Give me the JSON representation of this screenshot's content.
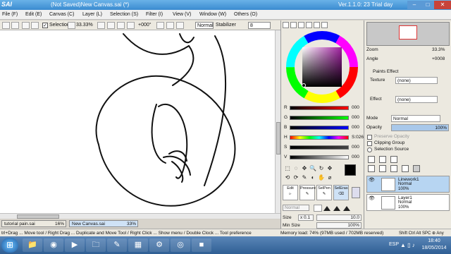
{
  "window": {
    "logo": "SAI",
    "title": "(Not Saved)New Canvas.sai (*)",
    "version": "Ver.1.1.0: 23 Trial day",
    "min_glyph": "–",
    "max_glyph": "□",
    "close_glyph": "✕"
  },
  "menu": [
    "File (F)",
    "Edit (E)",
    "Canvas (C)",
    "Layer (L)",
    "Selection (S)",
    "Filter (I)",
    "View (V)",
    "Window (W)",
    "Others (O)"
  ],
  "toolbar": {
    "selection_label": "Selection",
    "zoom": "33.33%",
    "angle": "+000°",
    "mode": "Normal",
    "stabilizer_label": "Stabilizer",
    "stabilizer_value": "8"
  },
  "doc_tabs": [
    {
      "name": "tutorial pain.sai",
      "zoom": "16%"
    },
    {
      "name": "New Canvas.sai",
      "zoom": "33%"
    }
  ],
  "status": {
    "hint": "trl+Drag ... Move tool / Right Drag ... Duplicate and Move Tool / Right Click ... Show menu / Double Clock ... Tool preference",
    "memory": "Memory load: 74% (97MB used / 702MB reserved)",
    "keys": "Shift Ctrl Alt SPC ⊕ Any"
  },
  "color_panel": {
    "sliders": [
      {
        "label": "R",
        "value": "000"
      },
      {
        "label": "G",
        "value": "000"
      },
      {
        "label": "B",
        "value": "000"
      },
      {
        "label": "H",
        "value": "S:026"
      },
      {
        "label": "S",
        "value": "000"
      },
      {
        "label": "V",
        "value": "000"
      }
    ],
    "tools": [
      "⬚",
      "◌",
      "✥",
      "🔍",
      "↻",
      "✥",
      "⟲",
      "⟳",
      "✎",
      "◐",
      "✋",
      "⌀"
    ],
    "brushes": [
      {
        "name": "Edit",
        "glyph": "▹"
      },
      {
        "name": "Pressure",
        "glyph": "✎"
      },
      {
        "name": "SelPen",
        "glyph": "✎"
      },
      {
        "name": "SelEras",
        "glyph": "⌫"
      }
    ],
    "mode": "Normal",
    "size_label": "Size",
    "size_mult": "x 0.1",
    "size_value": "10.0",
    "min_size_label": "Min Size",
    "min_size_value": "100%",
    "primary_color": "#000000",
    "secondary_color": "#ffffff"
  },
  "navigator": {
    "zoom_label": "Zoom",
    "zoom_value": "33.3%",
    "angle_label": "Angle",
    "angle_value": "+0008"
  },
  "layer_panel": {
    "paints_effect": "Paints Effect",
    "texture_label": "Texture",
    "texture_value": "(none)",
    "effect_label": "Effect",
    "effect_value": "(none)",
    "mode_label": "Mode",
    "mode_value": "Normal",
    "opacity_label": "Opacity",
    "opacity_value": "100%",
    "preserve_opacity": "Preserve Opacity",
    "clipping_group": "Clipping Group",
    "selection_source": "Selection Source",
    "layers": [
      {
        "name": "Linework1",
        "mode": "Normal",
        "opacity": "100%",
        "selected": true
      },
      {
        "name": "Layer1",
        "mode": "Normal",
        "opacity": "100%",
        "selected": false
      }
    ]
  },
  "taskbar": {
    "start_glyph": "⊞",
    "apps": [
      "📁",
      "◉",
      "▶",
      "🗀",
      "✎",
      "▦",
      "⚙",
      "◎",
      "■"
    ],
    "lang": "ESP",
    "tray": "▲ ▯ ♪",
    "time": "18:40",
    "date": "18/05/2014"
  }
}
